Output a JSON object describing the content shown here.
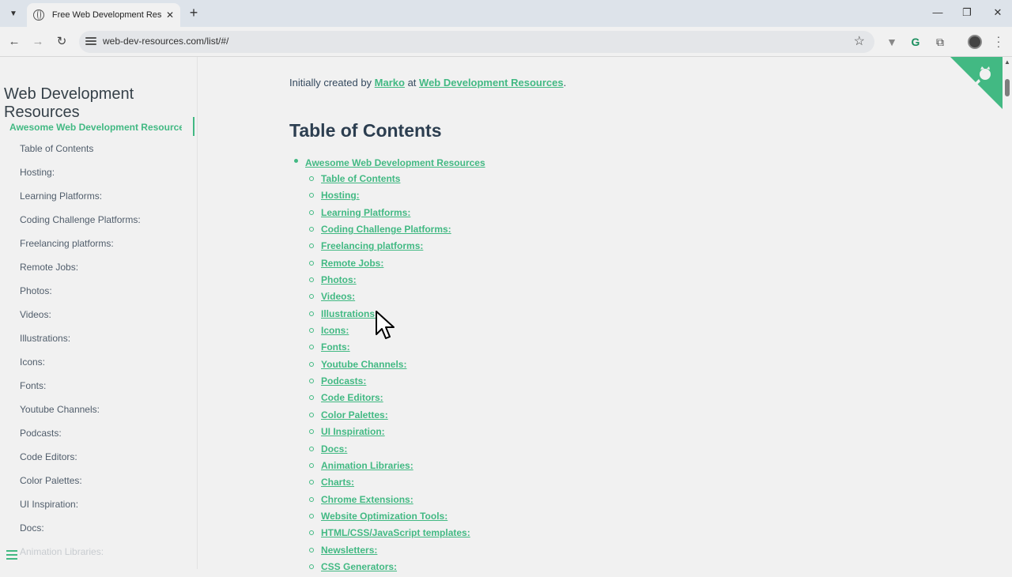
{
  "browser": {
    "tab_title": "Free Web Development Resources",
    "tab_close": "✕",
    "new_tab": "+",
    "url": "web-dev-resources.com/list/#/",
    "window_controls": {
      "minimize": "—",
      "restore": "❐",
      "close": "✕"
    },
    "icons": [
      "chevron-down-icon",
      "globe-icon",
      "back-arrow-icon",
      "forward-arrow-icon",
      "reload-icon",
      "site-info-icon",
      "bookmark-star-icon",
      "extension-v-icon",
      "grammarly-icon",
      "puzzle-extensions-icon",
      "profile-avatar",
      "kebab-menu-icon"
    ]
  },
  "sidebar": {
    "title": "Web Development Resources",
    "active_item": "Awesome Web Development Resources ...",
    "items": [
      "Table of Contents",
      "Hosting:",
      "Learning Platforms:",
      "Coding Challenge Platforms:",
      "Freelancing platforms:",
      "Remote Jobs:",
      "Photos:",
      "Videos:",
      "Illustrations:",
      "Icons:",
      "Fonts:",
      "Youtube Channels:",
      "Podcasts:",
      "Code Editors:",
      "Color Palettes:",
      "UI Inspiration:",
      "Docs:",
      "Animation Libraries:"
    ]
  },
  "content": {
    "intro_prefix": "Initially created by ",
    "intro_author": "Marko",
    "intro_mid": " at ",
    "intro_site": "Web Development Resources",
    "intro_suffix": ".",
    "toc_heading": "Table of Contents",
    "toc_root": "Awesome Web Development Resources",
    "toc_items": [
      "Table of Contents",
      "Hosting:",
      "Learning Platforms:",
      "Coding Challenge Platforms:",
      "Freelancing platforms:",
      "Remote Jobs:",
      "Photos:",
      "Videos:",
      "Illustrations:",
      "Icons:",
      "Fonts:",
      "Youtube Channels:",
      "Podcasts:",
      "Code Editors:",
      "Color Palettes:",
      "UI Inspiration:",
      "Docs:",
      "Animation Libraries:",
      "Charts:",
      "Chrome Extensions:",
      "Website Optimization Tools:",
      "HTML/CSS/JavaScript templates:",
      "Newsletters:",
      "CSS Generators:"
    ]
  },
  "colors": {
    "accent": "#42b983",
    "heading": "#2c3e50",
    "text": "#34495e",
    "background": "#f1f1f1"
  }
}
